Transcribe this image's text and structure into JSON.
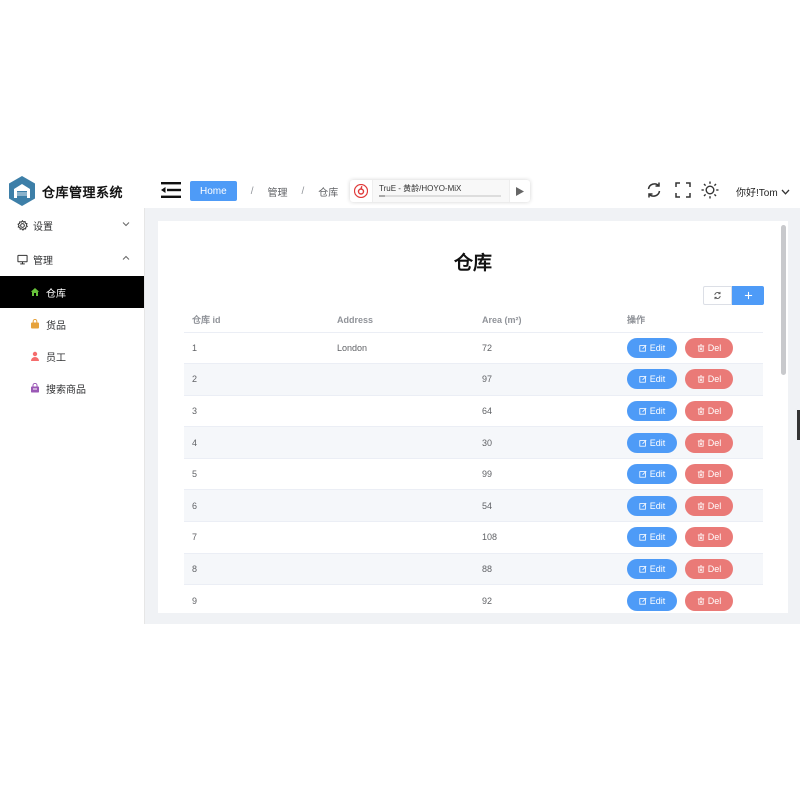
{
  "app": {
    "title": "仓库管理系统"
  },
  "header": {
    "breadcrumb": [
      "Home",
      "管理",
      "仓库"
    ],
    "player": {
      "track": "TruE - 黄龄/HOYO-MiX",
      "progress": 0.05
    },
    "greeting": "你好!Tom"
  },
  "sidebar": {
    "menus": [
      {
        "label": "设置",
        "icon": "gear-icon",
        "expanded": false
      },
      {
        "label": "管理",
        "icon": "monitor-icon",
        "expanded": true
      }
    ],
    "submenu": [
      {
        "label": "仓库",
        "icon": "home-icon",
        "color": "#67c23a",
        "active": true
      },
      {
        "label": "货品",
        "icon": "bag-icon",
        "color": "#e6a23c",
        "active": false
      },
      {
        "label": "员工",
        "icon": "user-icon",
        "color": "#f56c6c",
        "active": false
      },
      {
        "label": "搜索商品",
        "icon": "shop-icon",
        "color": "#9b59b6",
        "active": false
      }
    ]
  },
  "main": {
    "title": "仓库",
    "table": {
      "headers": [
        "仓库 id",
        "Address",
        "Area (m²)",
        "操作"
      ],
      "rows": [
        {
          "id": "1",
          "address": "London",
          "area": "72"
        },
        {
          "id": "2",
          "address": "",
          "area": "97"
        },
        {
          "id": "3",
          "address": "",
          "area": "64"
        },
        {
          "id": "4",
          "address": "",
          "area": "30"
        },
        {
          "id": "5",
          "address": "",
          "area": "99"
        },
        {
          "id": "6",
          "address": "",
          "area": "54"
        },
        {
          "id": "7",
          "address": "",
          "area": "108"
        },
        {
          "id": "8",
          "address": "",
          "area": "88"
        },
        {
          "id": "9",
          "address": "",
          "area": "92"
        }
      ],
      "edit_label": "Edit",
      "del_label": "Del"
    }
  },
  "colors": {
    "primary": "#4e9bf7",
    "danger": "#ea7a77",
    "active_menu": "#000000"
  }
}
